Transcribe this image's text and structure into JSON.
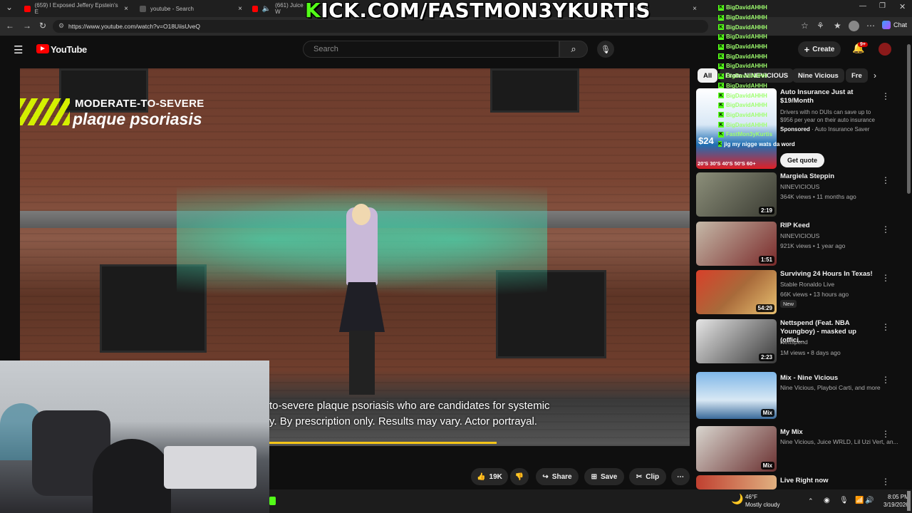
{
  "browser": {
    "tabs": [
      {
        "title": "(659) I Exposed Jeffery Epstein's E"
      },
      {
        "title": "youtube - Search"
      },
      {
        "title": "(661) Juice W"
      },
      {
        "title": "Search"
      }
    ],
    "url": "https://www.youtube.com/watch?v=O18UiisUveQ",
    "chat_button": "Chat"
  },
  "youtube": {
    "logo": "YouTube",
    "search_placeholder": "Search",
    "create_label": "Create",
    "notif_badge": "9+"
  },
  "video": {
    "ad_line1": "MODERATE-TO-SEVERE",
    "ad_line2": "plaque psoriasis",
    "caption_line1": "to-severe plaque psoriasis who are candidates for systemic",
    "caption_line2": "y. By prescription only. Results may vary. Actor portrayal.",
    "progress": 0.54
  },
  "actions": {
    "likes": "19K",
    "share": "Share",
    "save": "Save",
    "clip": "Clip"
  },
  "chips": [
    "All",
    "From NINEVICIOUS",
    "Nine Vicious",
    "Fre"
  ],
  "ad": {
    "title": "Auto Insurance Just at $19/Month",
    "desc": "Drivers with no DUIs can save up to $956 per year on their auto insurance",
    "sponsored": "Sponsored",
    "advertiser": "Auto Insurance Saver",
    "cta": "Get quote",
    "thumb_price": "$24",
    "thumb_ages": "20'S 30'S 40'S 50'S 60+"
  },
  "recs": [
    {
      "title": "Margiela Steppin",
      "channel": "NINEVICIOUS",
      "meta": "364K views • 11 months ago",
      "duration": "2:19",
      "badge": ""
    },
    {
      "title": "RIP Keed",
      "channel": "NINEVICIOUS",
      "meta": "921K views • 1 year ago",
      "duration": "1:51",
      "badge": ""
    },
    {
      "title": "Surviving 24 Hours In Texas!",
      "channel": "Stable Ronaldo Live",
      "meta": "66K views • 13 hours ago",
      "duration": "54:29",
      "badge": "New"
    },
    {
      "title": "Nettspend (Feat. NBA Youngboy) - masked up (offici...",
      "channel": "Nettspend",
      "meta": "1M views • 8 days ago",
      "duration": "2:23",
      "badge": ""
    },
    {
      "title": "Mix - Nine Vicious",
      "channel": "Nine Vicious, Playboi Carti, and more",
      "meta": "",
      "duration": "Mix",
      "badge": ""
    },
    {
      "title": "My Mix",
      "channel": "Nine Vicious, Juice WRLD, Lil Uzi Vert, an...",
      "meta": "",
      "duration": "Mix",
      "badge": ""
    },
    {
      "title": "Live Right now",
      "channel": "",
      "meta": "",
      "duration": "",
      "badge": ""
    }
  ],
  "overlay": {
    "kick_prefix": "K",
    "kick_rest": "ICK.COM/FASTMON3YKURTIS",
    "chat_name": "BigDavidAHHH",
    "chat_lines": [
      "BigDavidAHHH",
      "BigDavidAHHH",
      "BigDavidAHHH",
      "BigDavidAHHH",
      "BigDavidAHHH",
      "BigDavidAHHH",
      "BigDavidAHHH",
      "BigDavidAHHH",
      "BigDavidAHHH",
      "BigDavidAHHH",
      "BigDavidAHHH",
      "BigDavidAHHH",
      "BigDavidAHHH",
      "FastMon3yKurtis",
      "jig my nigge wats da word"
    ]
  },
  "taskbar": {
    "weather_temp": "46°F",
    "weather_desc": "Mostly cloudy",
    "time": "8:05 PM",
    "date": "3/19/2026"
  },
  "colors": {
    "accent": "#ff0000",
    "kick_green": "#53fc18",
    "progress": "#f5c518"
  }
}
